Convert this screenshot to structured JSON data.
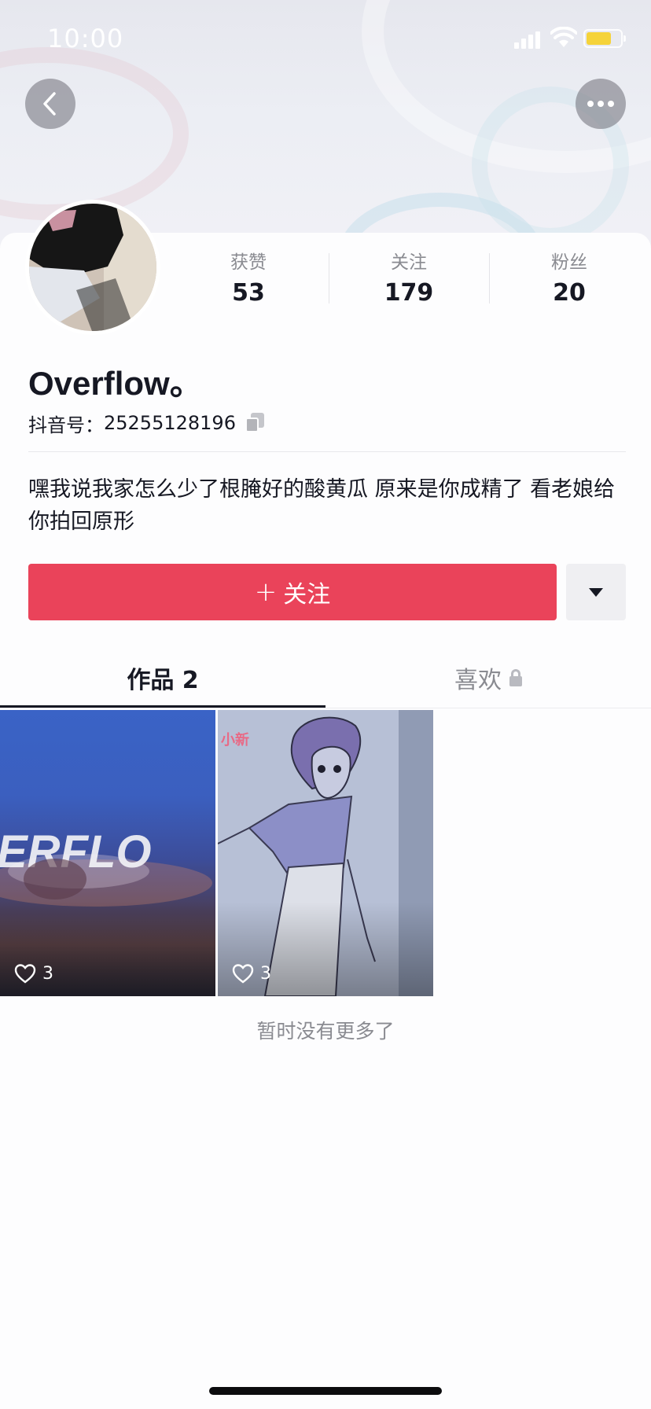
{
  "status_bar": {
    "time": "10:00",
    "battery_level": 0.74,
    "battery_color": "#f5d33a"
  },
  "nav": {
    "back_icon": "chevron-left-icon",
    "more_icon": "ellipsis-icon"
  },
  "profile": {
    "nickname": "Overflow。",
    "douyin_id_label": "抖音号：",
    "douyin_id": "25255128196",
    "bio": "嘿我说我家怎么少了根腌好的酸黄瓜 原来是你成精了 看老娘给你拍回原形",
    "stats": [
      {
        "label": "获赞",
        "value": "53"
      },
      {
        "label": "关注",
        "value": "179"
      },
      {
        "label": "粉丝",
        "value": "20"
      }
    ]
  },
  "actions": {
    "follow_plus": "+",
    "follow_label": "关注",
    "follow_color": "#ea435a"
  },
  "tabs": {
    "works_label": "作品 2",
    "likes_label": "喜欢"
  },
  "videos": [
    {
      "likes": "3",
      "overlay_text": "ERFLO"
    },
    {
      "likes": "3",
      "overlay_text": "小新"
    }
  ],
  "footer": {
    "no_more": "暂时没有更多了"
  }
}
